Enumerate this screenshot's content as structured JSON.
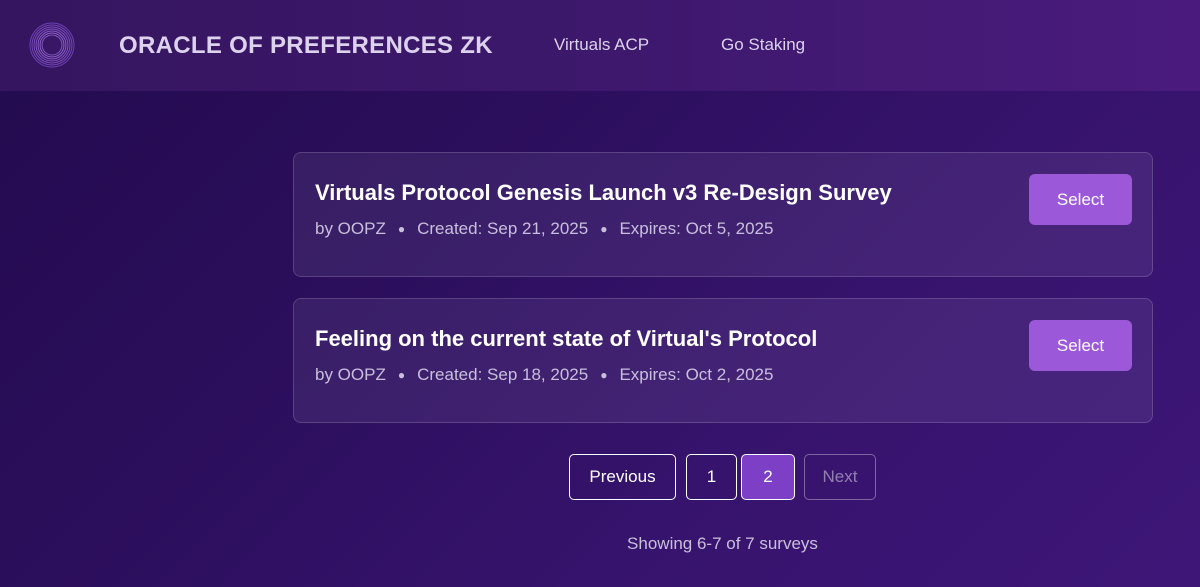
{
  "header": {
    "brand": "ORACLE OF PREFERENCES ZK",
    "nav": [
      "Virtuals ACP",
      "Go Staking"
    ],
    "logo_icon": "concentric-rings-logo-icon"
  },
  "surveys": [
    {
      "title": "Virtuals Protocol Genesis Launch v3 Re-Design Survey",
      "author": "by OOPZ",
      "created": "Created: Sep 21, 2025",
      "expires": "Expires: Oct 5, 2025",
      "action": "Select"
    },
    {
      "title": "Feeling on the current state of Virtual's Protocol",
      "author": "by OOPZ",
      "created": "Created: Sep 18, 2025",
      "expires": "Expires: Oct 2, 2025",
      "action": "Select"
    }
  ],
  "pagination": {
    "previous": "Previous",
    "pages": [
      "1",
      "2"
    ],
    "current": "2",
    "next": "Next"
  },
  "status": "Showing 6-7 of 7 surveys",
  "colors": {
    "accent": "#9b59d9",
    "active_page": "#7d3fc6",
    "background": "#2b0e5c"
  }
}
